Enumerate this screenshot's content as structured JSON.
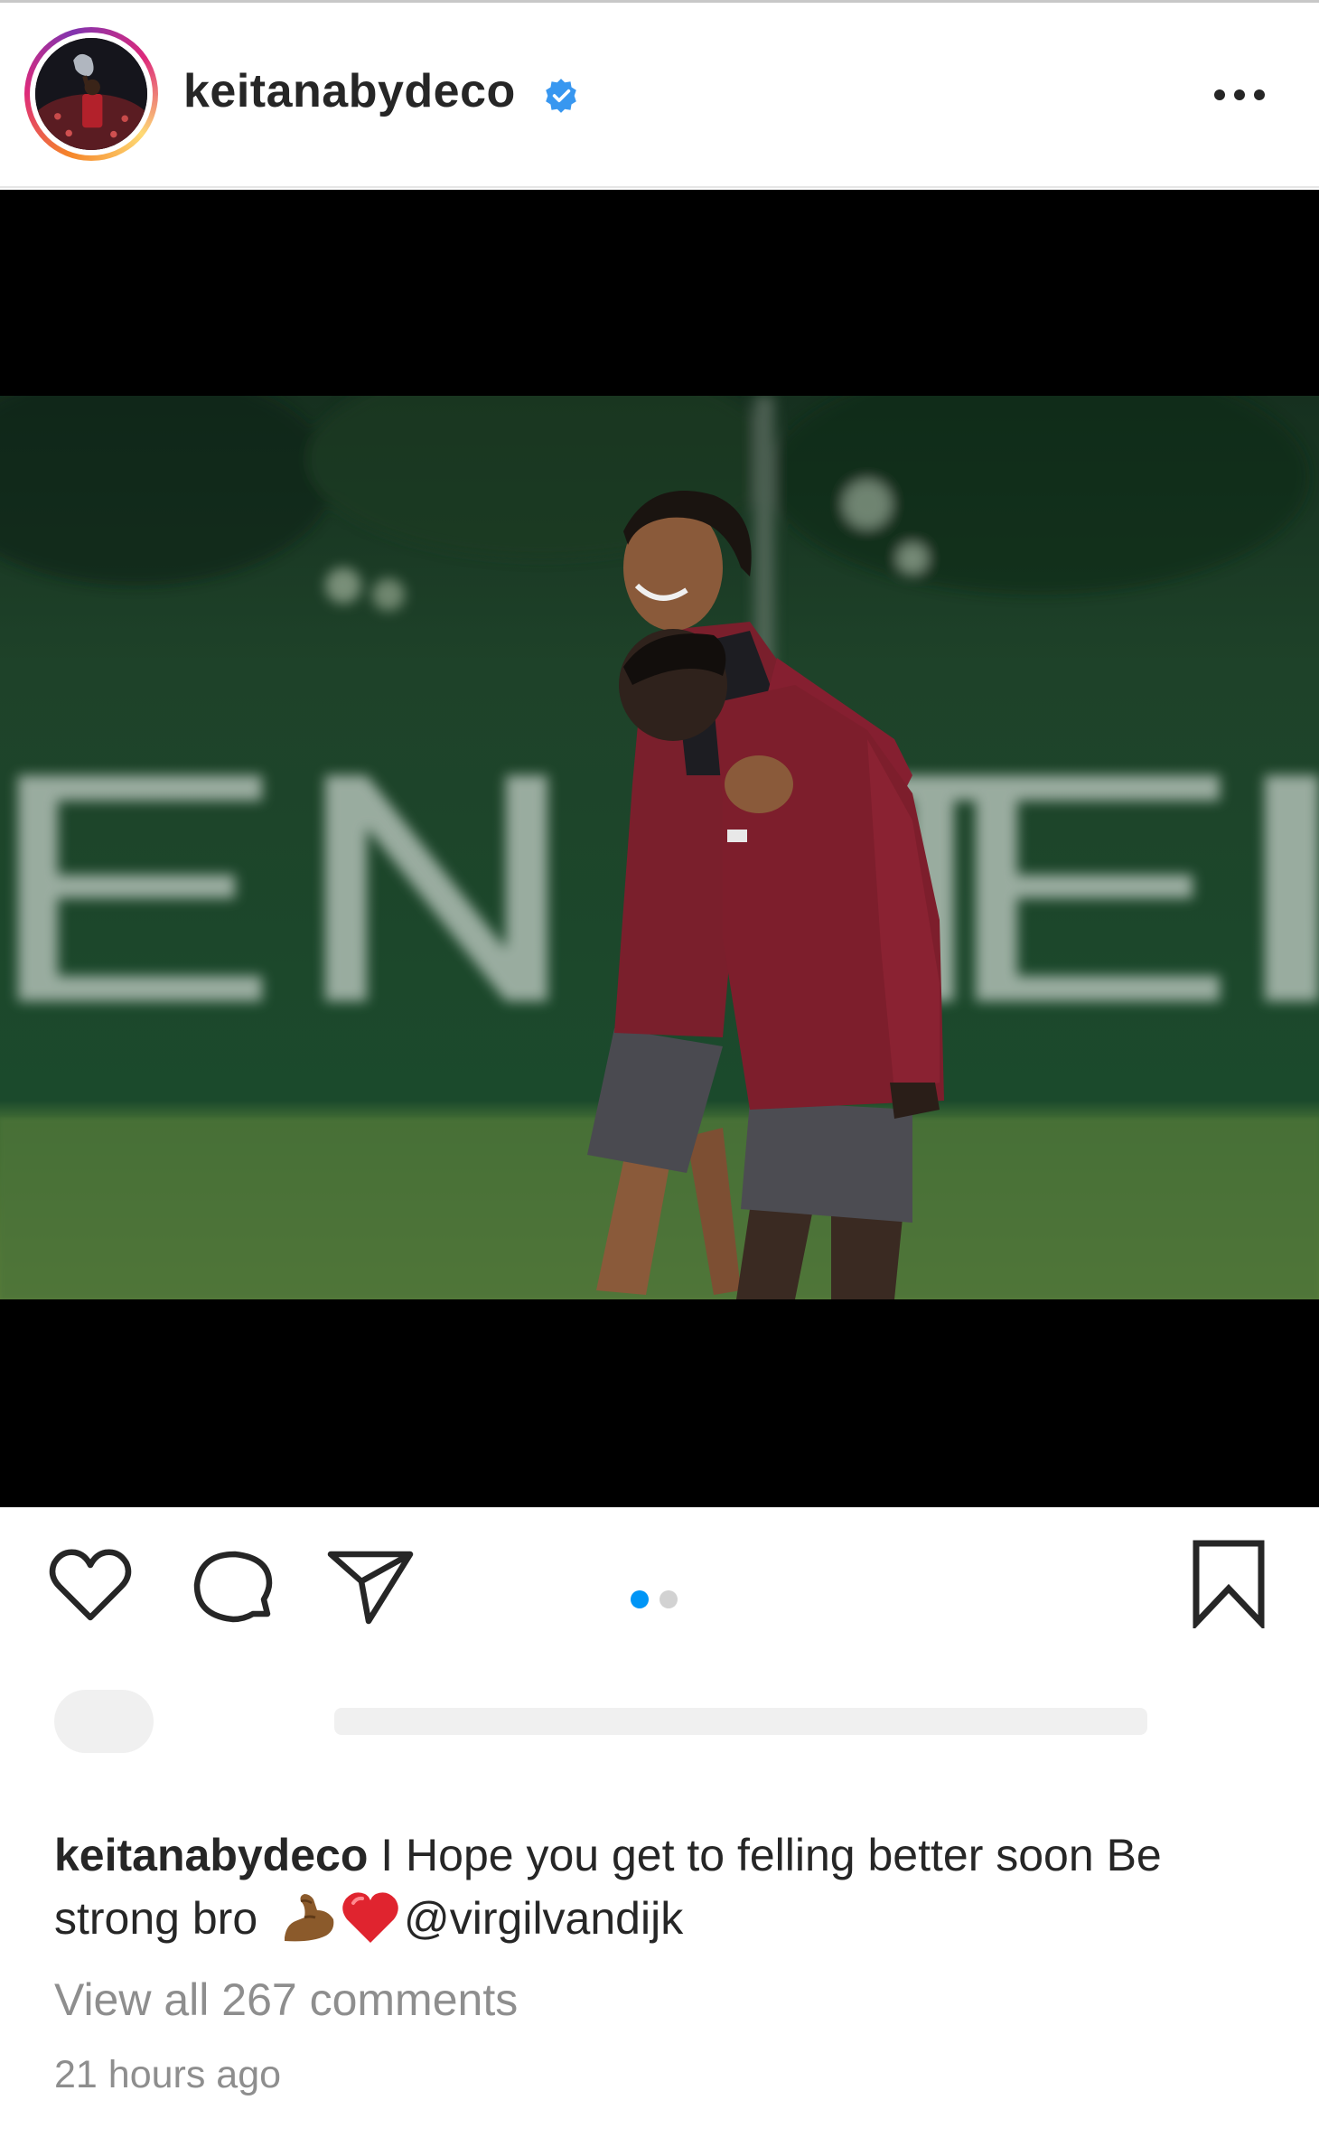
{
  "post": {
    "username": "keitanabydeco",
    "verified": true,
    "more_icon": "more-horizontal-icon",
    "media": {
      "type": "carousel",
      "slide_count": 2,
      "active_slide": 1,
      "background_text": "ENTE"
    },
    "actions": {
      "like_icon": "heart-icon",
      "comment_icon": "comment-icon",
      "share_icon": "send-icon",
      "save_icon": "bookmark-icon"
    },
    "caption": {
      "username": "keitanabydeco",
      "text": " I Hope you get to felling better soon Be strong bro ",
      "emoji_1": "flexed-biceps-emoji",
      "emoji_2": "red-heart-emoji",
      "mention": "@virgilvandijk"
    },
    "view_comments": "View all 267 comments",
    "timestamp": "21 hours ago"
  },
  "colors": {
    "text": "#262626",
    "muted": "#8e8e8e",
    "accent_blue": "#0095f6",
    "verified_blue": "#3897f0",
    "heart_red": "#e0242f"
  }
}
